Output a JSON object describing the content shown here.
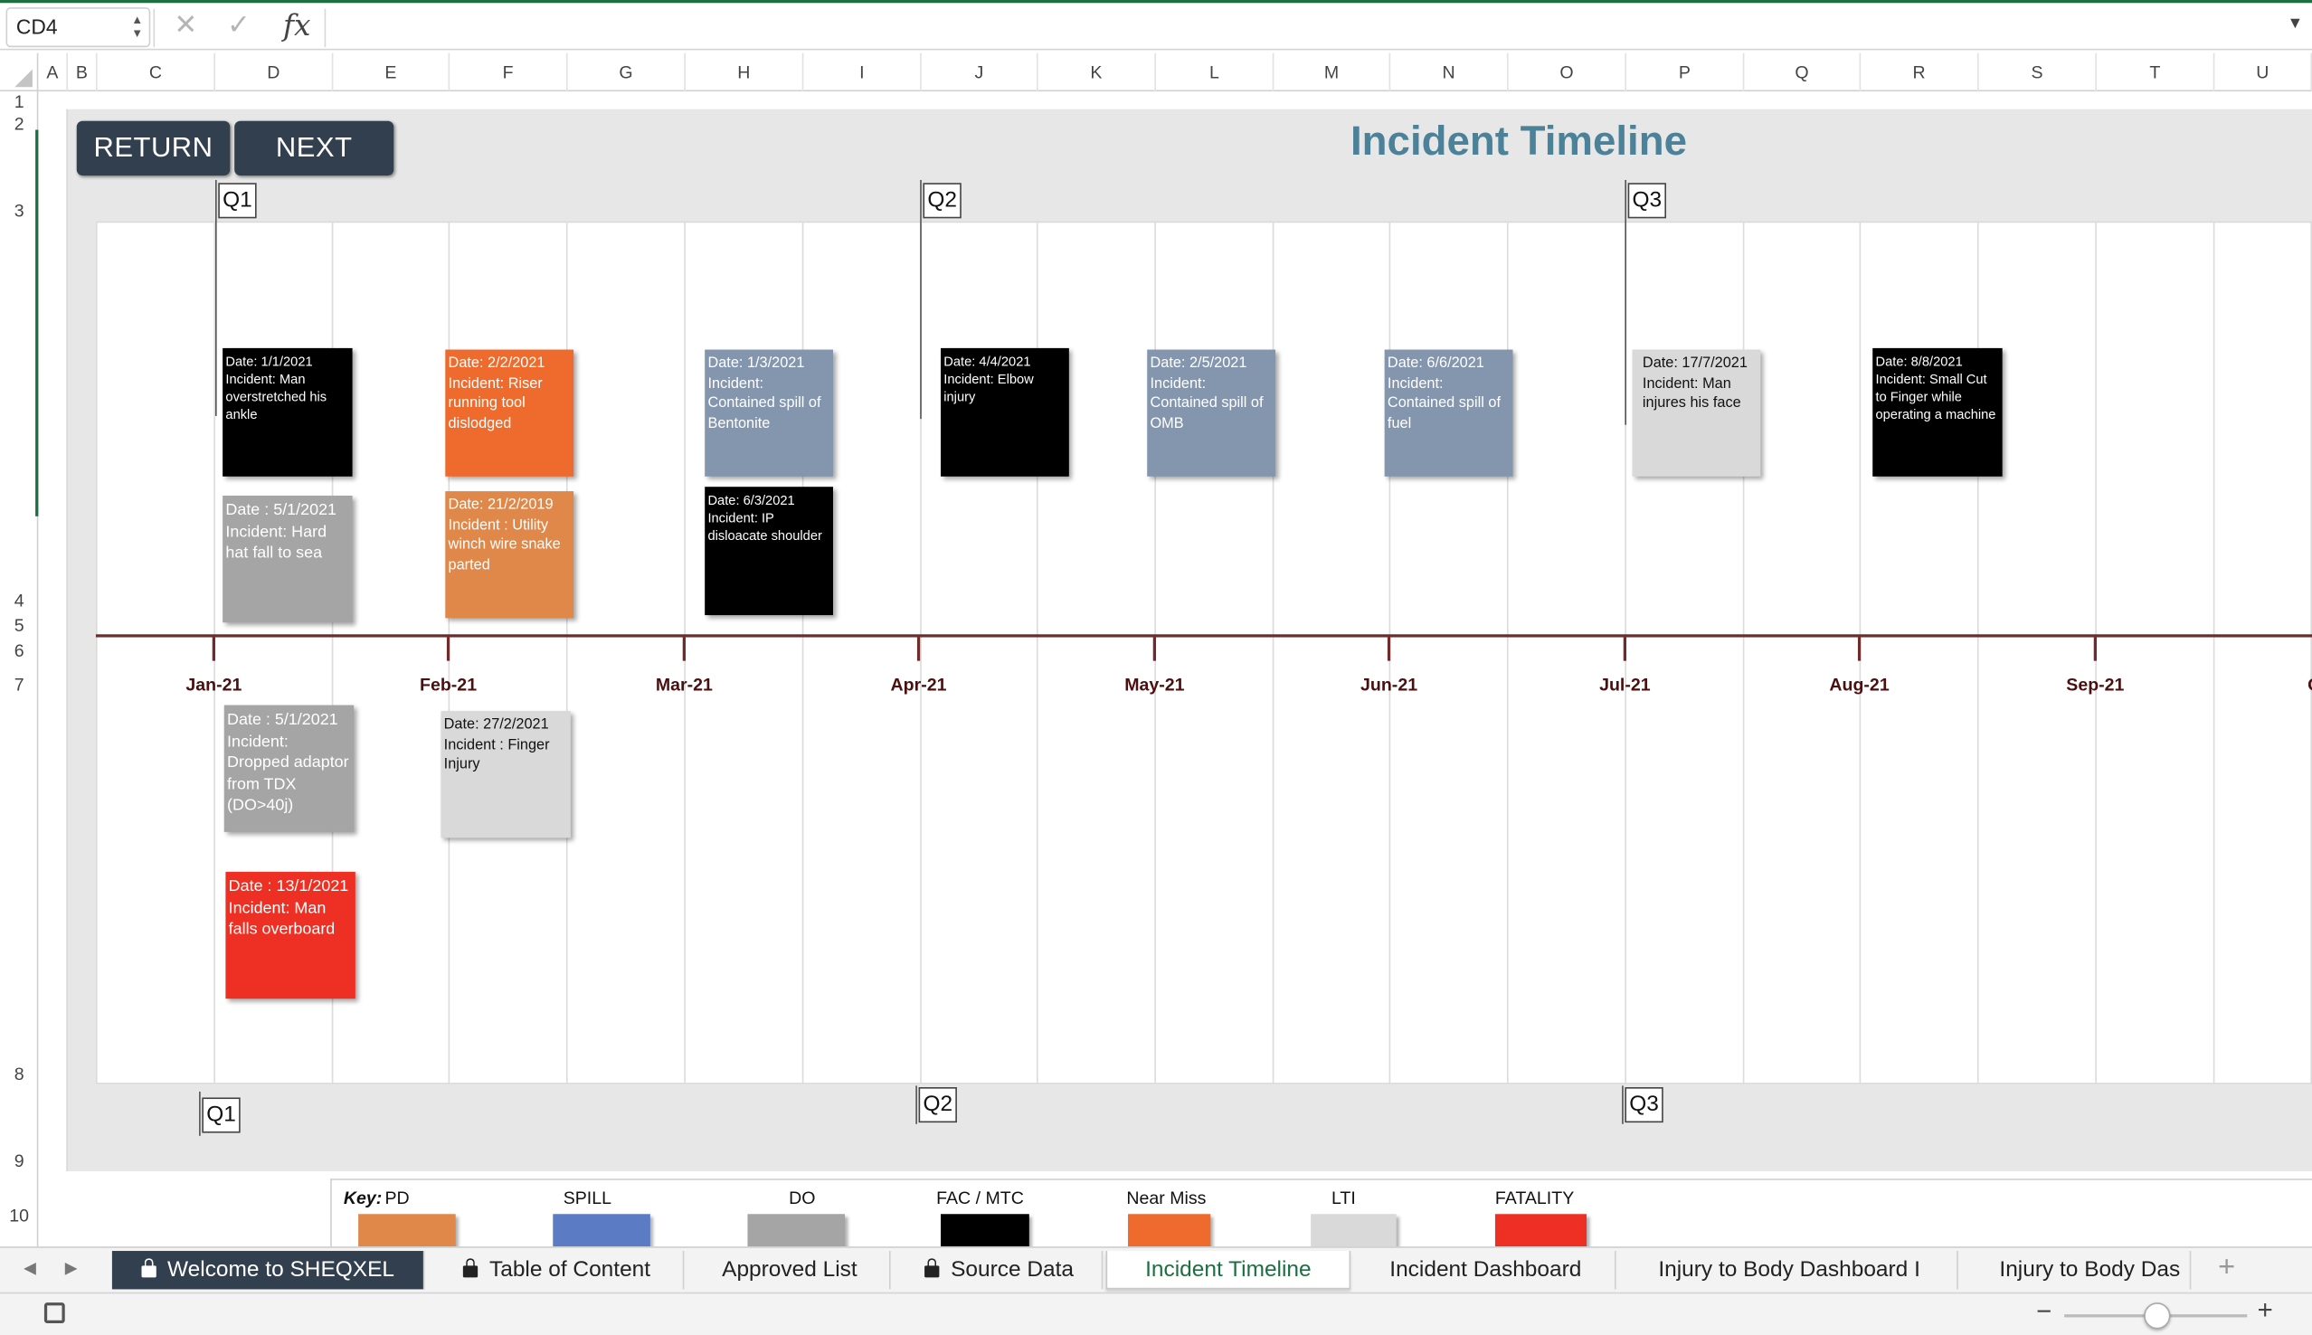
{
  "formula_bar": {
    "name_box": "CD4",
    "cancel_icon": "✕",
    "enter_icon": "✓",
    "fx_label": "fx",
    "formula": ""
  },
  "columns": [
    "A",
    "B",
    "C",
    "D",
    "E",
    "F",
    "G",
    "H",
    "I",
    "J",
    "K",
    "L",
    "M",
    "N",
    "O",
    "P",
    "Q",
    "R",
    "S",
    "T",
    "U"
  ],
  "rows": [
    "1",
    "2",
    "3",
    "4",
    "5",
    "6",
    "7",
    "8",
    "9",
    "10"
  ],
  "buttons": {
    "return": "RETURN",
    "next": "NEXT"
  },
  "title": "Incident Timeline",
  "quarters": {
    "top": [
      "Q1",
      "Q2",
      "Q3"
    ],
    "bottom": [
      "Q1",
      "Q2",
      "Q3"
    ]
  },
  "months": [
    "Jan-21",
    "Feb-21",
    "Mar-21",
    "Apr-21",
    "May-21",
    "Jun-21",
    "Jul-21",
    "Aug-21",
    "Sep-21",
    "O"
  ],
  "incidents": [
    {
      "text": "Date: 1/1/2021\nIncident: Man overstretched his ankle",
      "category": "FAC / MTC",
      "color": "#000000"
    },
    {
      "text": "Date : 5/1/2021\nIncident: Hard hat fall to sea",
      "category": "DO",
      "color": "#a5a5a5"
    },
    {
      "text": "Date: 2/2/2021\nIncident: Riser running tool dislodged",
      "category": "Near Miss",
      "color": "#ee6b2d"
    },
    {
      "text": "Date: 21/2/2019\nIncident : Utility winch wire snake parted",
      "category": "PD",
      "color": "#e0874a"
    },
    {
      "text": "Date: 1/3/2021\nIncident: Contained spill of Bentonite",
      "category": "SPILL",
      "color": "#8496ae"
    },
    {
      "text": "Date: 6/3/2021\nIncident: IP disloacate shoulder",
      "category": "FAC / MTC",
      "color": "#000000"
    },
    {
      "text": "Date: 4/4/2021\nIncident: Elbow injury",
      "category": "FAC / MTC",
      "color": "#000000"
    },
    {
      "text": "Date: 2/5/2021\nIncident: Contained spill of OMB",
      "category": "SPILL",
      "color": "#8496ae"
    },
    {
      "text": "Date: 6/6/2021\nIncident: Contained spill of fuel",
      "category": "SPILL",
      "color": "#8496ae"
    },
    {
      "text": "Date: 17/7/2021\nIncident: Man injures his face",
      "category": "LTI",
      "color": "#d9d9d9"
    },
    {
      "text": "Date: 8/8/2021\nIncident: Small Cut to Finger while operating a machine",
      "category": "FAC / MTC",
      "color": "#000000"
    },
    {
      "text": "Date : 5/1/2021\nIncident: Dropped adaptor from TDX (DO>40j)",
      "category": "DO",
      "color": "#a5a5a5"
    },
    {
      "text": "Date: 27/2/2021\nIncident : Finger Injury",
      "category": "LTI",
      "color": "#d9d9d9"
    },
    {
      "text": "Date : 13/1/2021\nIncident:  Man falls overboard",
      "category": "FATALITY",
      "color": "#ee3024"
    }
  ],
  "key": {
    "title": "Key:",
    "items": [
      {
        "label": "PD",
        "color": "#e0874a"
      },
      {
        "label": "SPILL",
        "color": "#5b7bc4"
      },
      {
        "label": "DO",
        "color": "#a5a5a5"
      },
      {
        "label": "FAC / MTC",
        "color": "#000000"
      },
      {
        "label": "Near Miss",
        "color": "#ee6b2d"
      },
      {
        "label": "LTI",
        "color": "#d9d9d9"
      },
      {
        "label": "FATALITY",
        "color": "#ee3024"
      }
    ]
  },
  "sheet_tabs": [
    {
      "label": "Welcome to SHEQXEL",
      "locked": true,
      "style": "dark"
    },
    {
      "label": "Table of Content",
      "locked": true
    },
    {
      "label": "Approved List",
      "locked": false
    },
    {
      "label": "Source Data",
      "locked": true
    },
    {
      "label": "Incident Timeline",
      "locked": false,
      "active": true
    },
    {
      "label": "Incident Dashboard",
      "locked": false
    },
    {
      "label": "Injury to Body Dashboard I",
      "locked": false
    },
    {
      "label": "Injury to Body Das",
      "locked": false
    }
  ],
  "tab_nav": {
    "prev": "◀",
    "next": "▶",
    "add": "+"
  },
  "status": {
    "zoom_minus": "−",
    "zoom_plus": "+"
  }
}
